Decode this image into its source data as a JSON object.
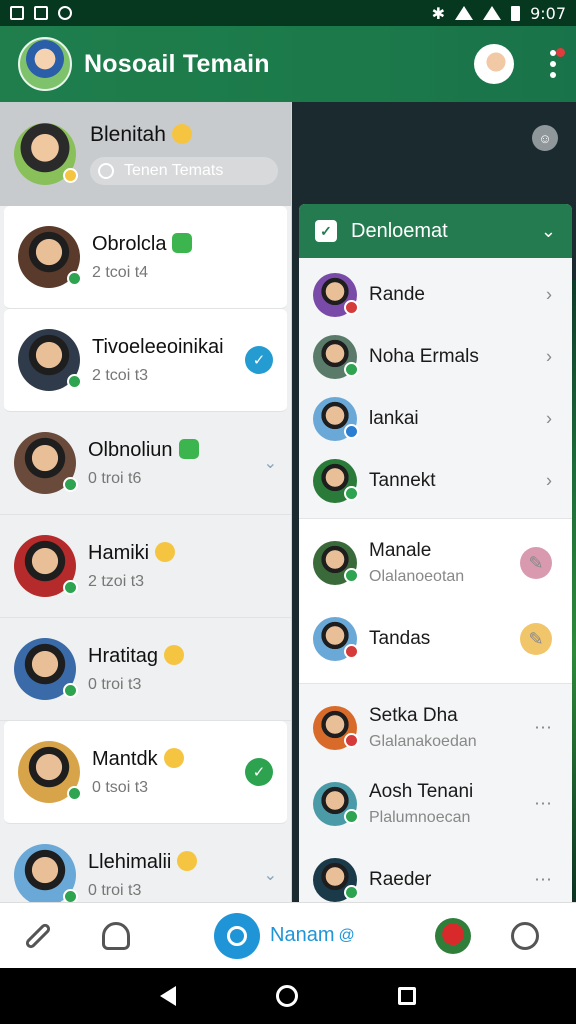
{
  "statusbar": {
    "time": "9:07"
  },
  "app": {
    "title": "Nosoail Temain"
  },
  "profile": {
    "name": "Blenitah",
    "search_text": "Tenen Temats"
  },
  "chats": [
    {
      "name": "Obrolcla",
      "sub": "2 tcoi t4",
      "badge": "green-emoji",
      "dot": "green",
      "trail": "",
      "card": true,
      "avatar": "#5a3a2a"
    },
    {
      "name": "Tivoeleeoinikai",
      "sub": "2 tcoi t3",
      "badge": "",
      "dot": "green",
      "trail": "blue-check",
      "card": true,
      "avatar": "#2f3b4a"
    },
    {
      "name": "Olbnoliun",
      "sub": "0 troi t6",
      "badge": "green-emoji",
      "dot": "green",
      "trail": "double-chevron",
      "card": false,
      "avatar": "#6a4a3a"
    },
    {
      "name": "Hamiki",
      "sub": "2 tzoi t3",
      "badge": "yellow-emoji",
      "dot": "green",
      "trail": "",
      "card": false,
      "avatar": "#b52a2a"
    },
    {
      "name": "Hratitag",
      "sub": "0 troi t3",
      "badge": "yellow-emoji",
      "dot": "green",
      "trail": "",
      "card": false,
      "avatar": "#3a6aa8"
    },
    {
      "name": "Mantdk",
      "sub": "0 tsoi t3",
      "badge": "yellow-emoji",
      "dot": "green",
      "trail": "green-check",
      "card": true,
      "avatar": "#d8a44a"
    },
    {
      "name": "Llehimalii",
      "sub": "0 troi t3",
      "badge": "yellow-emoji",
      "dot": "green",
      "trail": "double-chevron",
      "card": false,
      "avatar": "#6aa8d8"
    }
  ],
  "rightpanel": {
    "title": "Denloemat",
    "group1": [
      {
        "name": "Rande",
        "dot": "red",
        "avatar": "#7a4aa8"
      },
      {
        "name": "Noha Ermals",
        "dot": "green",
        "avatar": "#5a7a6a"
      },
      {
        "name": "lankai",
        "dot": "blue",
        "avatar": "#6aa8d8"
      },
      {
        "name": "Tannekt",
        "dot": "green",
        "avatar": "#2a7a3a"
      }
    ],
    "group2": [
      {
        "name": "Manale",
        "sub": "Olalanoeotan",
        "bubble_color": "#d99ab0",
        "dot": "green",
        "avatar": "#3a6a3a"
      },
      {
        "name": "Tandas",
        "sub": "",
        "bubble_color": "#f1c56a",
        "dot": "red",
        "avatar": "#6aa8d8"
      }
    ],
    "group3": [
      {
        "name": "Setka Dha",
        "sub": "Glalanakoedan",
        "dot": "red",
        "avatar": "#d86a2a"
      },
      {
        "name": "Aosh Tenani",
        "sub": "Plalumnoecan",
        "dot": "green",
        "avatar": "#4a9aa8"
      },
      {
        "name": "Raeder",
        "sub": "",
        "dot": "green",
        "avatar": "#1a3a4a"
      }
    ]
  },
  "bottomnav": {
    "active_label": "Nanam"
  }
}
